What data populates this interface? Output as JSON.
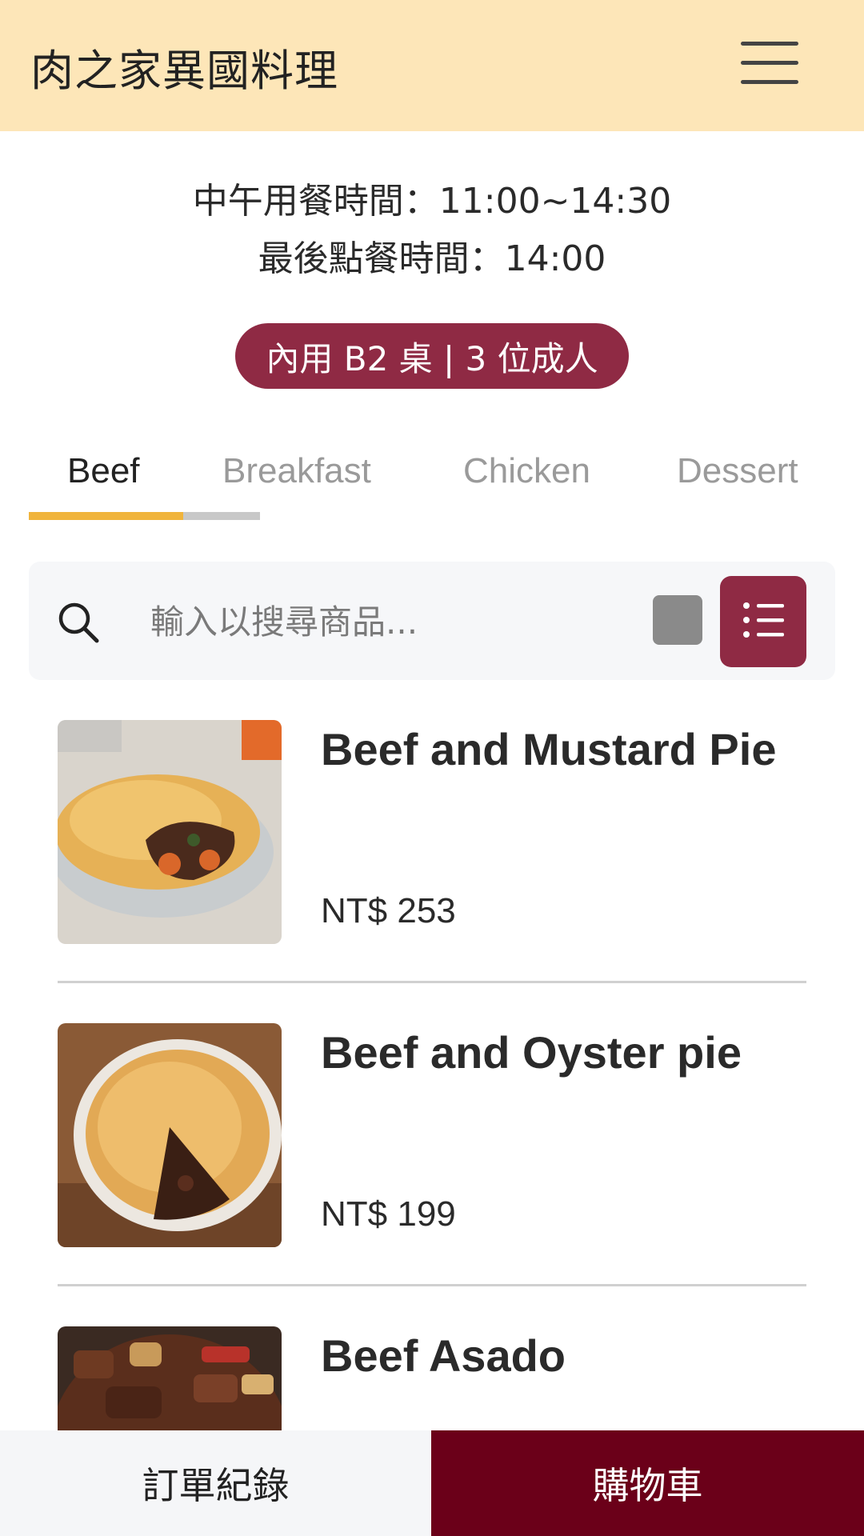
{
  "header": {
    "title": "肉之家異國料理",
    "menu_icon": "hamburger-menu-icon"
  },
  "hours": {
    "lunch": "中午用餐時間：11:00~14:30",
    "last_order": "最後點餐時間：14:00"
  },
  "table_badge": "內用 B2 桌 | 3 位成人",
  "tabs": [
    {
      "label": "Beef",
      "active": true
    },
    {
      "label": "Breakfast",
      "active": false
    },
    {
      "label": "Chicken",
      "active": false
    },
    {
      "label": "Dessert",
      "active": false
    }
  ],
  "search": {
    "placeholder": "輸入以搜尋商品...",
    "value": ""
  },
  "view_toggle": {
    "grid_icon": "grid-view-icon",
    "list_icon": "list-view-icon",
    "selected": "list"
  },
  "products": [
    {
      "name": "Beef and Mustard Pie",
      "price": "NT$ 253"
    },
    {
      "name": "Beef and Oyster pie",
      "price": "NT$ 199"
    },
    {
      "name": "Beef Asado",
      "price": ""
    }
  ],
  "bottom_bar": {
    "order_history": "訂單紀錄",
    "cart": "購物車"
  },
  "colors": {
    "header_bg": "#fde6b8",
    "accent": "#8f2a44",
    "cart_bg": "#6b0019",
    "tab_indicator": "#f0b43c"
  }
}
